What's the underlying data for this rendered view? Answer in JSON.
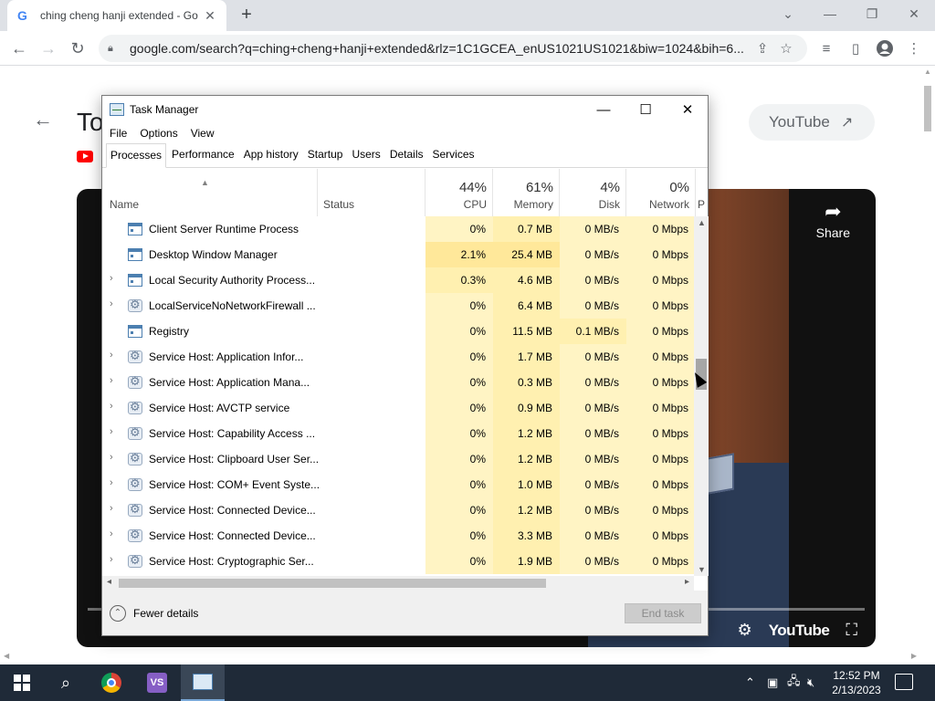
{
  "browser": {
    "tab_title": "ching cheng hanji extended - Go",
    "url": "google.com/search?q=ching+cheng+hanji+extended&rlz=1C1GCEA_enUS1021US1021&biw=1024&bih=6..."
  },
  "page": {
    "title_fragment": "To",
    "chip_label": "YouTube",
    "share_label": "Share",
    "player_brand": "YouTube"
  },
  "taskmanager": {
    "title": "Task Manager",
    "menu": [
      "File",
      "Options",
      "View"
    ],
    "tabs": [
      "Processes",
      "Performance",
      "App history",
      "Startup",
      "Users",
      "Details",
      "Services"
    ],
    "active_tab": "Processes",
    "columns": {
      "name": "Name",
      "status": "Status",
      "cpu": {
        "label": "CPU",
        "pct": "44%"
      },
      "memory": {
        "label": "Memory",
        "pct": "61%"
      },
      "disk": {
        "label": "Disk",
        "pct": "4%"
      },
      "network": {
        "label": "Network",
        "pct": "0%"
      },
      "power_fragment": "P"
    },
    "processes": [
      {
        "name": "Client Server Runtime Process",
        "icon": "window-icon",
        "expandable": false,
        "cpu": "0%",
        "memory": "0.7 MB",
        "disk": "0 MB/s",
        "network": "0 Mbps"
      },
      {
        "name": "Desktop Window Manager",
        "icon": "window-icon",
        "expandable": false,
        "cpu": "2.1%",
        "memory": "25.4 MB",
        "disk": "0 MB/s",
        "network": "0 Mbps"
      },
      {
        "name": "Local Security Authority Process...",
        "icon": "window-icon",
        "expandable": true,
        "cpu": "0.3%",
        "memory": "4.6 MB",
        "disk": "0 MB/s",
        "network": "0 Mbps"
      },
      {
        "name": "LocalServiceNoNetworkFirewall ...",
        "icon": "gear-icon",
        "expandable": true,
        "cpu": "0%",
        "memory": "6.4 MB",
        "disk": "0 MB/s",
        "network": "0 Mbps"
      },
      {
        "name": "Registry",
        "icon": "window-icon",
        "expandable": false,
        "cpu": "0%",
        "memory": "11.5 MB",
        "disk": "0.1 MB/s",
        "network": "0 Mbps"
      },
      {
        "name": "Service Host: Application Infor...",
        "icon": "gear-icon",
        "expandable": true,
        "cpu": "0%",
        "memory": "1.7 MB",
        "disk": "0 MB/s",
        "network": "0 Mbps"
      },
      {
        "name": "Service Host: Application Mana...",
        "icon": "gear-icon",
        "expandable": true,
        "cpu": "0%",
        "memory": "0.3 MB",
        "disk": "0 MB/s",
        "network": "0 Mbps"
      },
      {
        "name": "Service Host: AVCTP service",
        "icon": "gear-icon",
        "expandable": true,
        "cpu": "0%",
        "memory": "0.9 MB",
        "disk": "0 MB/s",
        "network": "0 Mbps"
      },
      {
        "name": "Service Host: Capability Access ...",
        "icon": "gear-icon",
        "expandable": true,
        "cpu": "0%",
        "memory": "1.2 MB",
        "disk": "0 MB/s",
        "network": "0 Mbps"
      },
      {
        "name": "Service Host: Clipboard User Ser...",
        "icon": "gear-icon",
        "expandable": true,
        "cpu": "0%",
        "memory": "1.2 MB",
        "disk": "0 MB/s",
        "network": "0 Mbps"
      },
      {
        "name": "Service Host: COM+ Event Syste...",
        "icon": "gear-icon",
        "expandable": true,
        "cpu": "0%",
        "memory": "1.0 MB",
        "disk": "0 MB/s",
        "network": "0 Mbps"
      },
      {
        "name": "Service Host: Connected Device...",
        "icon": "gear-icon",
        "expandable": true,
        "cpu": "0%",
        "memory": "1.2 MB",
        "disk": "0 MB/s",
        "network": "0 Mbps"
      },
      {
        "name": "Service Host: Connected Device...",
        "icon": "gear-icon",
        "expandable": true,
        "cpu": "0%",
        "memory": "3.3 MB",
        "disk": "0 MB/s",
        "network": "0 Mbps"
      },
      {
        "name": "Service Host: Cryptographic Ser...",
        "icon": "gear-icon",
        "expandable": true,
        "cpu": "0%",
        "memory": "1.9 MB",
        "disk": "0 MB/s",
        "network": "0 Mbps"
      }
    ],
    "footer": {
      "fewer_details": "Fewer details",
      "end_task": "End task"
    }
  },
  "taskbar": {
    "time": "12:52 PM",
    "date": "2/13/2023",
    "apps": [
      "start-button",
      "search-icon",
      "chrome-icon",
      "visual-studio-icon",
      "task-manager-icon"
    ]
  },
  "colors": {
    "heat_light": "#fff4c4",
    "heat_mid": "#fff0b0",
    "heat_strong": "#ffe89a",
    "taskbar": "#1f2a38",
    "chrome_tabstrip": "#dee1e6"
  }
}
